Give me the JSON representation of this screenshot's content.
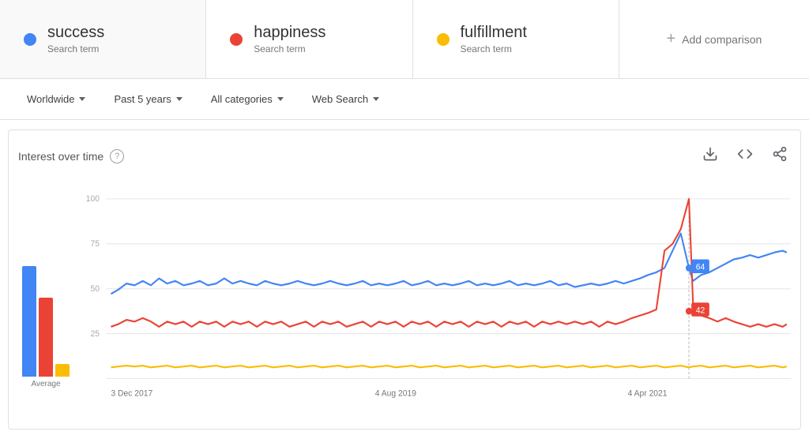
{
  "terms": [
    {
      "id": "success",
      "label": "success",
      "type": "Search term",
      "color": "#4285F4"
    },
    {
      "id": "happiness",
      "label": "happiness",
      "type": "Search term",
      "color": "#EA4335"
    },
    {
      "id": "fulfillment",
      "label": "fulfillment",
      "type": "Search term",
      "color": "#FBBC04"
    }
  ],
  "add_comparison": "+ Add comparison",
  "filters": [
    {
      "id": "region",
      "label": "Worldwide"
    },
    {
      "id": "time",
      "label": "Past 5 years"
    },
    {
      "id": "category",
      "label": "All categories"
    },
    {
      "id": "search_type",
      "label": "Web Search"
    }
  ],
  "chart": {
    "title": "Interest over time",
    "x_labels": [
      "3 Dec 2017",
      "4 Aug 2019",
      "4 Apr 2021"
    ],
    "y_labels": [
      "100",
      "75",
      "50",
      "25"
    ],
    "avg_label": "Average"
  },
  "icons": {
    "download": "⬇",
    "code": "<>",
    "share": "⬆"
  }
}
